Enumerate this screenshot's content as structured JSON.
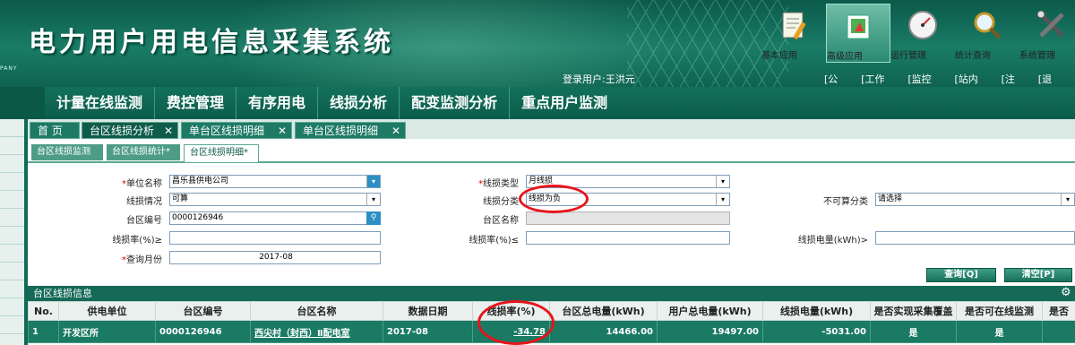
{
  "app": {
    "title": "电力用户用电信息采集系统",
    "company_fragment": "PANY",
    "login_user": "登录用户:王洪元"
  },
  "modules": [
    {
      "label": "基本应用",
      "icon": "document-pen-icon",
      "active": false
    },
    {
      "label": "高级应用",
      "icon": "flag-arrow-icon",
      "active": true
    },
    {
      "label": "运行管理",
      "icon": "gauge-icon",
      "active": false
    },
    {
      "label": "统计查询",
      "icon": "magnifier-icon",
      "active": false
    },
    {
      "label": "系统管理",
      "icon": "tools-icon",
      "active": false
    }
  ],
  "toplinks": [
    "[公告]",
    "[工作台]",
    "[监控台]",
    "[站内信]",
    "[注销]",
    "[退出]"
  ],
  "nav": [
    "计量在线监测",
    "费控管理",
    "有序用电",
    "线损分析",
    "配变监测分析",
    "重点用户监测"
  ],
  "tabs": [
    {
      "label": "首  页",
      "closable": false
    },
    {
      "label": "台区线损分析",
      "closable": true,
      "active": true
    },
    {
      "label": "单台区线损明细",
      "closable": true
    },
    {
      "label": "单台区线损明细",
      "closable": true
    }
  ],
  "subtabs": [
    {
      "label": "台区线损监测"
    },
    {
      "label": "台区线损统计*"
    },
    {
      "label": "台区线损明细*",
      "active": true
    }
  ],
  "form": {
    "unit_name_label": "单位名称",
    "unit_name_value": "昌乐县供电公司",
    "loss_type_label": "线损类型",
    "loss_type_value": "月线损",
    "loss_status_label": "线损情况",
    "loss_status_value": "可算",
    "loss_class_label": "线损分类",
    "loss_class_value": "线损为负",
    "noncalc_class_label": "不可算分类",
    "noncalc_class_value": "请选择",
    "area_no_label": "台区编号",
    "area_no_value": "0000126946",
    "area_name_label": "台区名称",
    "area_name_value": "",
    "rate_ge_label": "线损率(%)≥",
    "rate_le_label": "线损率(%)≤",
    "loss_kwh_label": "线损电量(kWh)>",
    "month_label": "查询月份",
    "month_value": "2017-08",
    "query_button": "查询[Q]",
    "clear_button": "清空[P]"
  },
  "table": {
    "section_title": "台区线损信息",
    "headers": [
      "No.",
      "供电单位",
      "台区编号",
      "台区名称",
      "数据日期",
      "线损率(%)",
      "台区总电量(kWh)",
      "用户总电量(kWh)",
      "线损电量(kWh)",
      "是否实现采集覆盖",
      "是否可在线监测",
      "是否"
    ],
    "rows": [
      [
        "1",
        "开发区所",
        "0000126946",
        "西尖村（封西）Ⅱ配电室",
        "2017-08",
        "-34.78",
        "14466.00",
        "19497.00",
        "-5031.00",
        "是",
        "是",
        ""
      ]
    ]
  },
  "colors": {
    "header_bg": "#0f6a57",
    "highlight_ring": "#e8141b",
    "row_bg": "#1a7a63"
  }
}
